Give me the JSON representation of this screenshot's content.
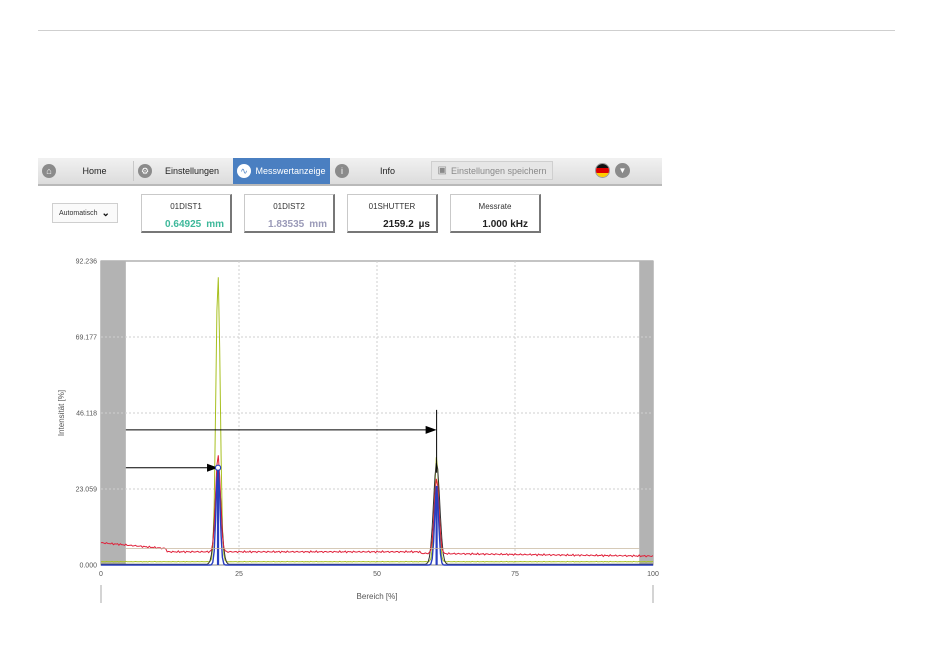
{
  "nav": {
    "home": "Home",
    "settings": "Einstellungen",
    "measure": "Messwertanzeige",
    "info": "Info",
    "save": "Einstellungen speichern"
  },
  "mode": {
    "value": "Automatisch"
  },
  "values": [
    {
      "label": "01DIST1",
      "value": "0.64925",
      "unit": "mm",
      "color": "#3db89a"
    },
    {
      "label": "01DIST2",
      "value": "1.83535",
      "unit": "mm",
      "color": "#9a9ab8"
    },
    {
      "label": "01SHUTTER",
      "value": "2159.2",
      "unit": "µs",
      "color": "#222222"
    },
    {
      "label": "Messrate",
      "value": "1.000 kHz",
      "unit": "",
      "color": "#222222"
    }
  ],
  "chart_data": {
    "type": "line",
    "xlabel": "Bereich [%]",
    "ylabel": "Intensität [%]",
    "xlim": [
      0,
      100
    ],
    "ylim": [
      0,
      92.236
    ],
    "x_ticks": [
      0,
      25,
      50,
      75,
      100
    ],
    "y_ticks": [
      "0.000",
      "23.059",
      "46.118",
      "69.177",
      "92.236"
    ],
    "masked_ranges": [
      [
        0,
        4.5
      ],
      [
        97.5,
        100
      ]
    ],
    "peaks": [
      {
        "x": 21.2,
        "red": 33.5,
        "yellow": 88.0,
        "blue": 30.0,
        "black": 28.0
      },
      {
        "x": 60.8,
        "red": 26.5,
        "yellow": 33.0,
        "blue": 24.0,
        "black": 31.0
      }
    ],
    "threshold_baseline": 5.0,
    "markers": [
      {
        "type": "arrow",
        "from_x": 4.5,
        "to_x": 21.2,
        "y": 29.5,
        "end": "circle"
      },
      {
        "type": "arrow",
        "from_x": 4.5,
        "to_x": 60.8,
        "y": 41.0,
        "end": "line"
      }
    ],
    "series_colors": {
      "red": "#e0213a",
      "yellow": "#a8c020",
      "blue": "#2a3fc0",
      "black": "#333333"
    }
  }
}
